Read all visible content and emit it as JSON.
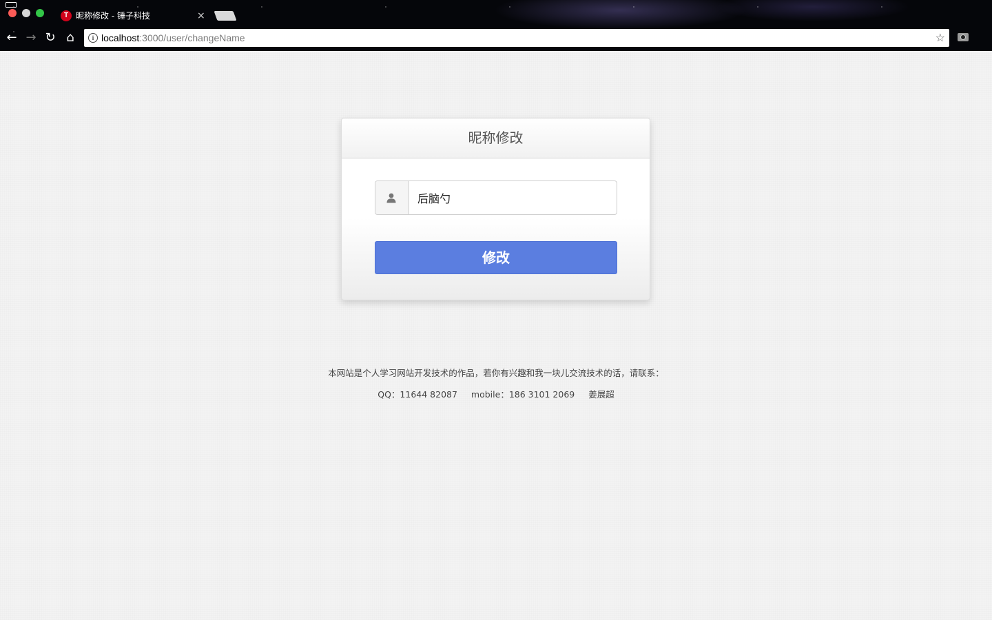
{
  "browser": {
    "tab_favicon_letter": "T",
    "tab_title": "昵称修改 - 锤子科技",
    "tab_close": "×",
    "url_host": "localhost",
    "url_path": ":3000/user/changeName",
    "info_glyph": "i",
    "star_glyph": "☆",
    "back_glyph": "←",
    "forward_glyph": "→",
    "reload_glyph": "↻",
    "home_glyph": "⌂",
    "icons": [
      "back-icon",
      "forward-icon",
      "reload-icon",
      "home-icon",
      "info-icon",
      "star-icon",
      "camera-icon"
    ]
  },
  "card": {
    "title": "昵称修改",
    "nickname_value": "后脑勺",
    "user_icon": "user-icon",
    "submit_label": "修改"
  },
  "footer": {
    "line1": "本网站是个人学习网站开发技术的作品，若你有兴趣和我一块儿交流技术的话，请联系：",
    "qq": "QQ：11644 82087",
    "mobile": "mobile：186 3101 2069",
    "name": "姜展超"
  },
  "colors": {
    "button": "#5b7ee0",
    "page_background": "#f3f3f3"
  }
}
